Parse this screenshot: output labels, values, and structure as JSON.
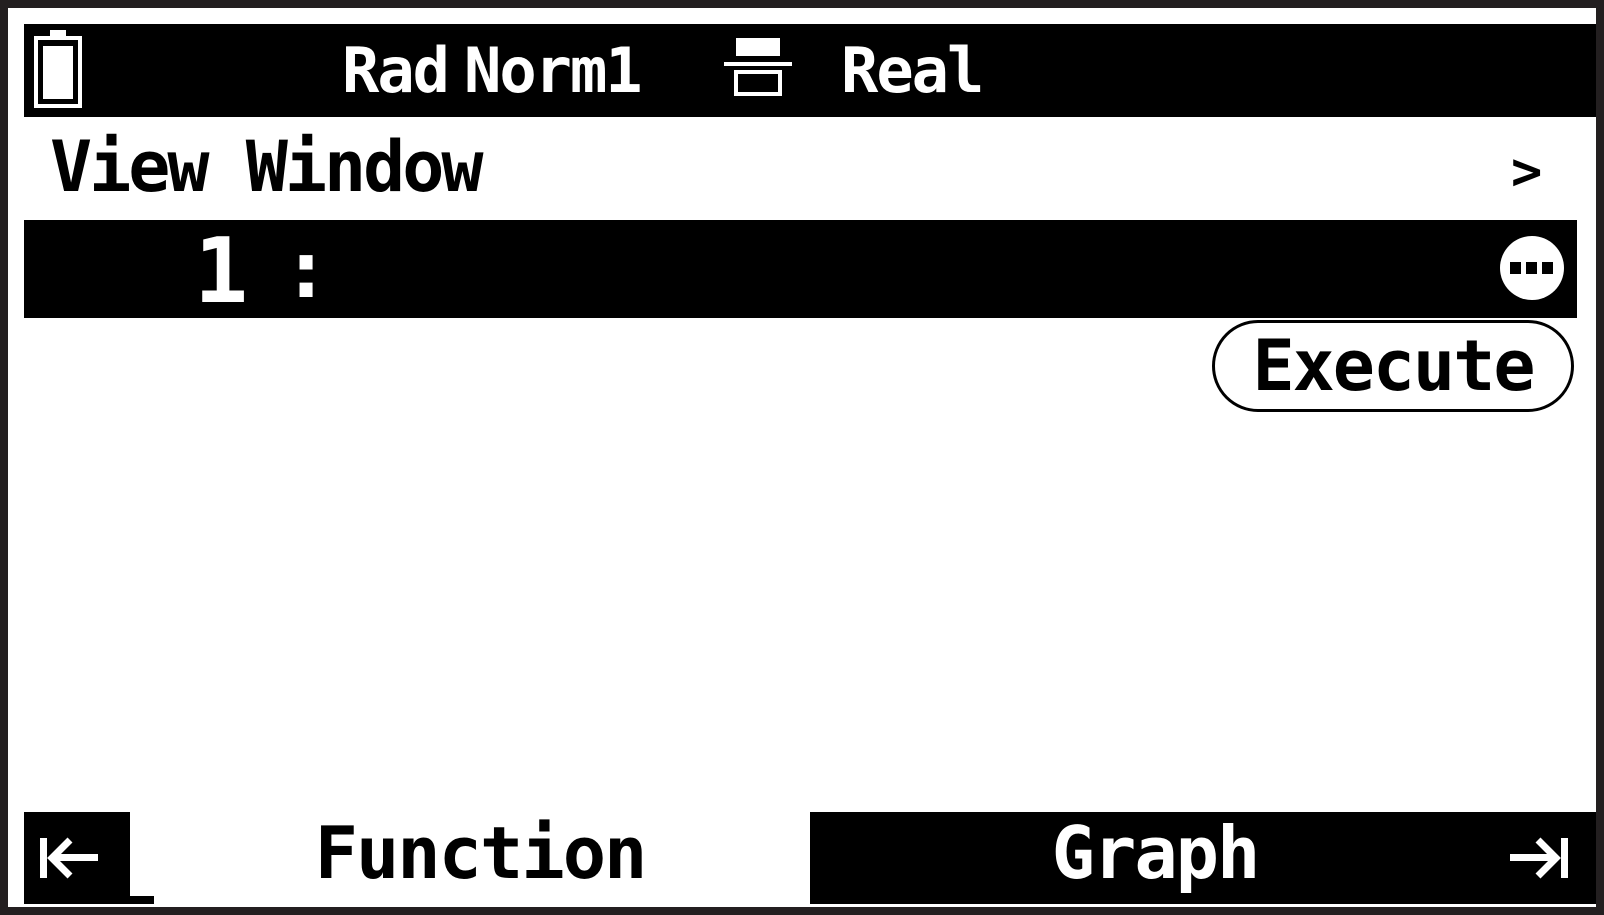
{
  "status_bar": {
    "battery_icon": "battery-icon",
    "angle_mode": "Rad",
    "display_mode": "Norm1",
    "fraction_icon": "fraction-format-icon",
    "complex_mode": "Real"
  },
  "header": {
    "title": "View Window",
    "more_icon": "chevron-right-icon"
  },
  "function_list": {
    "items": [
      {
        "index": "1",
        "separator": ":",
        "expression": ""
      }
    ],
    "options_icon": "more-options-icon"
  },
  "actions": {
    "execute_label": "Execute"
  },
  "softkeys": {
    "first_icon": "jump-to-start-icon",
    "function_label": "Function",
    "graph_label": "Graph",
    "last_icon": "jump-to-end-icon"
  },
  "colors": {
    "foreground": "#000000",
    "background": "#ffffff",
    "frame": "#231f20"
  }
}
